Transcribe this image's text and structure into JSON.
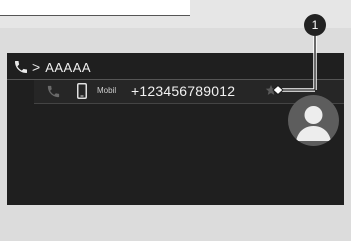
{
  "callout": {
    "number": "1"
  },
  "header": {
    "separator": ">",
    "contact_name": "AAAAA"
  },
  "entry": {
    "type_label": "Mobil",
    "number": "+123456789012"
  },
  "icons": {
    "header": "phone-icon",
    "row_call": "phone-icon",
    "row_type": "mobile-phone-icon",
    "favorite": "star-icon",
    "avatar": "person-icon"
  },
  "colors": {
    "screen_bg": "#1f1f1f",
    "page_bg": "#dcdcdc",
    "text": "#f2f2f2",
    "muted_icon": "#6a6a6a",
    "avatar_bg": "#5d5d5d"
  }
}
